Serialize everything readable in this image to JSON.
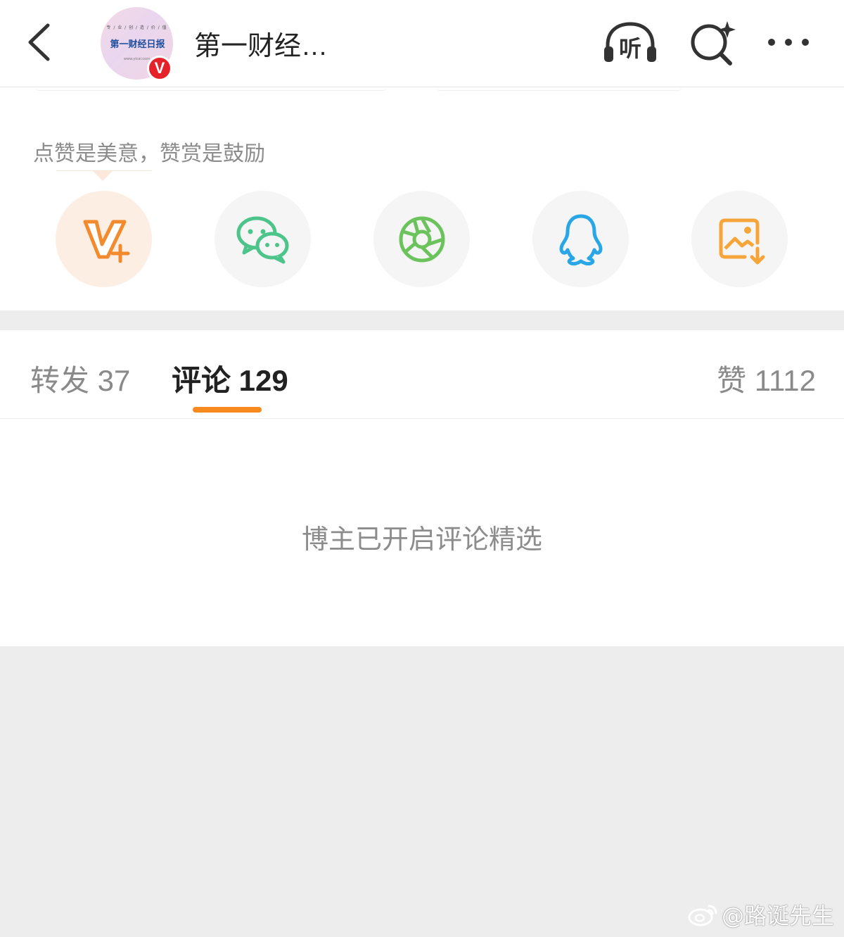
{
  "header": {
    "title": "第一财经…",
    "avatar": {
      "top_text": "专 / 业 / 创 / 造 / 价 / 值",
      "logo_text": "第一财经日报",
      "url_text": "www.yicai.com",
      "badge": "V"
    },
    "listen_label": "听"
  },
  "reward": {
    "label": "点赞是美意，赞赏是鼓励",
    "share_items": [
      "vip-reward-icon",
      "wechat-icon",
      "moments-icon",
      "qq-icon",
      "save-image-icon"
    ]
  },
  "tabs": {
    "repost": "转发 37",
    "comment": "评论 129",
    "like": "赞 1112",
    "active": "comment"
  },
  "comments": {
    "notice": "博主已开启评论精选"
  },
  "watermark": {
    "text": "@路诞先生"
  },
  "colors": {
    "accent": "#f78a1e",
    "verified_badge": "#e5212a",
    "wechat_green": "#4cc48a",
    "moments_green": "#6cc35e",
    "qq_blue": "#29a6e6",
    "save_orange": "#f6a53a"
  }
}
